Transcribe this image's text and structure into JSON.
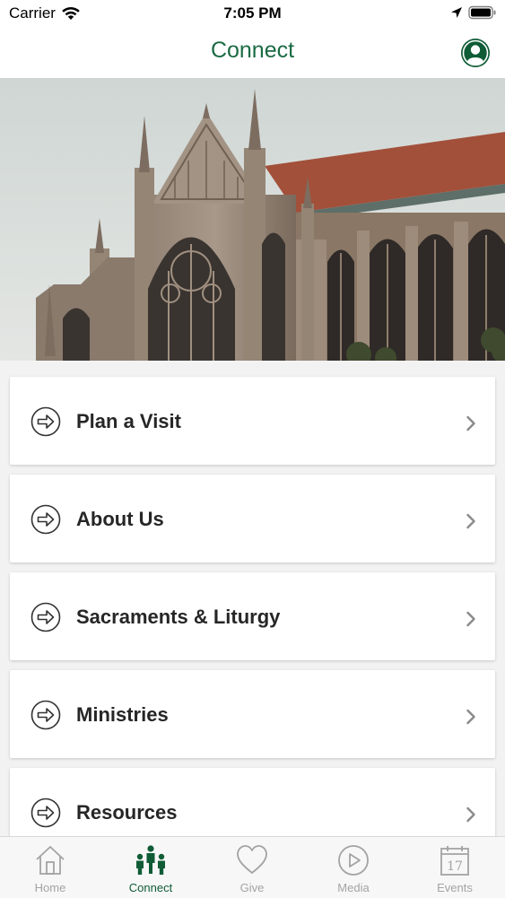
{
  "status_bar": {
    "carrier": "Carrier",
    "time": "7:05 PM"
  },
  "nav": {
    "title": "Connect"
  },
  "colors": {
    "accent": "#1b6b44",
    "accent_dark": "#0f5c36",
    "inactive": "#a3a3a3"
  },
  "menu_items": [
    {
      "label": "Plan a Visit",
      "icon": "arrow-circle-right-icon"
    },
    {
      "label": "About Us",
      "icon": "arrow-circle-right-icon"
    },
    {
      "label": "Sacraments & Liturgy",
      "icon": "arrow-circle-right-icon"
    },
    {
      "label": "Ministries",
      "icon": "arrow-circle-right-icon"
    },
    {
      "label": "Resources",
      "icon": "arrow-circle-right-icon"
    }
  ],
  "tabs": [
    {
      "label": "Home",
      "icon": "home-icon",
      "active": false
    },
    {
      "label": "Connect",
      "icon": "people-icon",
      "active": true
    },
    {
      "label": "Give",
      "icon": "heart-icon",
      "active": false
    },
    {
      "label": "Media",
      "icon": "play-icon",
      "active": false
    },
    {
      "label": "Events",
      "icon": "calendar-icon",
      "active": false,
      "calendar_day": "17"
    }
  ]
}
